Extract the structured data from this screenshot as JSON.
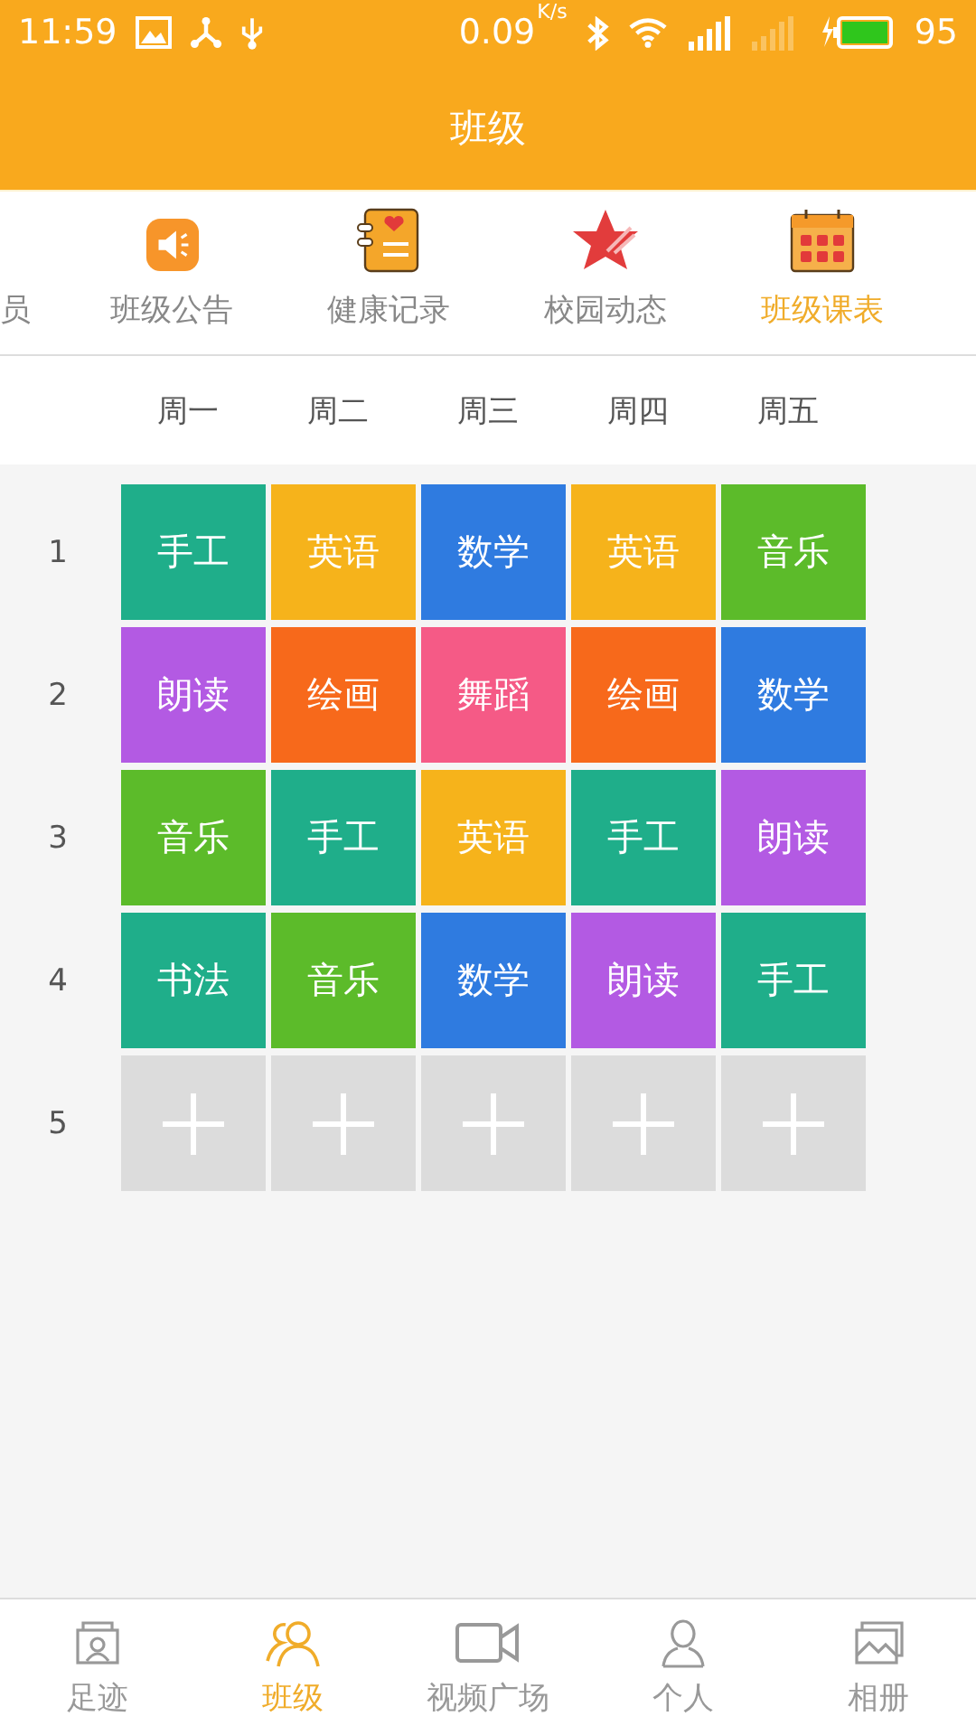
{
  "status_bar": {
    "time": "11:59",
    "speed": "0.09",
    "speed_unit": "K/s",
    "battery": "95"
  },
  "app_bar": {
    "title": "班级"
  },
  "tabs": [
    {
      "label": "员",
      "kind": "partial",
      "selected": false
    },
    {
      "label": "班级公告",
      "kind": "speaker",
      "selected": false
    },
    {
      "label": "健康记录",
      "kind": "notebook",
      "selected": false
    },
    {
      "label": "校园动态",
      "kind": "star",
      "selected": false
    },
    {
      "label": "班级课表",
      "kind": "calendar",
      "selected": true
    }
  ],
  "timetable": {
    "days": [
      "周一",
      "周二",
      "周三",
      "周四",
      "周五"
    ],
    "rows": [
      {
        "period": "1",
        "cells": [
          {
            "kind": "lesson",
            "subject": "手工",
            "color": "#1fae8a"
          },
          {
            "kind": "lesson",
            "subject": "英语",
            "color": "#f6b31b"
          },
          {
            "kind": "lesson",
            "subject": "数学",
            "color": "#2f7be0"
          },
          {
            "kind": "lesson",
            "subject": "英语",
            "color": "#f6b31b"
          },
          {
            "kind": "lesson",
            "subject": "音乐",
            "color": "#5cbb2a"
          }
        ]
      },
      {
        "period": "2",
        "cells": [
          {
            "kind": "lesson",
            "subject": "朗读",
            "color": "#b35ae3"
          },
          {
            "kind": "lesson",
            "subject": "绘画",
            "color": "#f7691b"
          },
          {
            "kind": "lesson",
            "subject": "舞蹈",
            "color": "#f55a86"
          },
          {
            "kind": "lesson",
            "subject": "绘画",
            "color": "#f7691b"
          },
          {
            "kind": "lesson",
            "subject": "数学",
            "color": "#2f7be0"
          }
        ]
      },
      {
        "period": "3",
        "cells": [
          {
            "kind": "lesson",
            "subject": "音乐",
            "color": "#5cbb2a"
          },
          {
            "kind": "lesson",
            "subject": "手工",
            "color": "#1fae8a"
          },
          {
            "kind": "lesson",
            "subject": "英语",
            "color": "#f6b31b"
          },
          {
            "kind": "lesson",
            "subject": "手工",
            "color": "#1fae8a"
          },
          {
            "kind": "lesson",
            "subject": "朗读",
            "color": "#b35ae3"
          }
        ]
      },
      {
        "period": "4",
        "cells": [
          {
            "kind": "lesson",
            "subject": "书法",
            "color": "#1fae8a"
          },
          {
            "kind": "lesson",
            "subject": "音乐",
            "color": "#5cbb2a"
          },
          {
            "kind": "lesson",
            "subject": "数学",
            "color": "#2f7be0"
          },
          {
            "kind": "lesson",
            "subject": "朗读",
            "color": "#b35ae3"
          },
          {
            "kind": "lesson",
            "subject": "手工",
            "color": "#1fae8a"
          }
        ]
      },
      {
        "period": "5",
        "cells": [
          {
            "kind": "empty"
          },
          {
            "kind": "empty"
          },
          {
            "kind": "empty"
          },
          {
            "kind": "empty"
          },
          {
            "kind": "empty"
          }
        ]
      }
    ]
  },
  "bottom_nav": [
    {
      "label": "足迹",
      "kind": "profile-card",
      "selected": false
    },
    {
      "label": "班级",
      "kind": "people",
      "selected": true
    },
    {
      "label": "视频广场",
      "kind": "video",
      "selected": false
    },
    {
      "label": "个人",
      "kind": "person",
      "selected": false
    },
    {
      "label": "相册",
      "kind": "album",
      "selected": false
    }
  ]
}
